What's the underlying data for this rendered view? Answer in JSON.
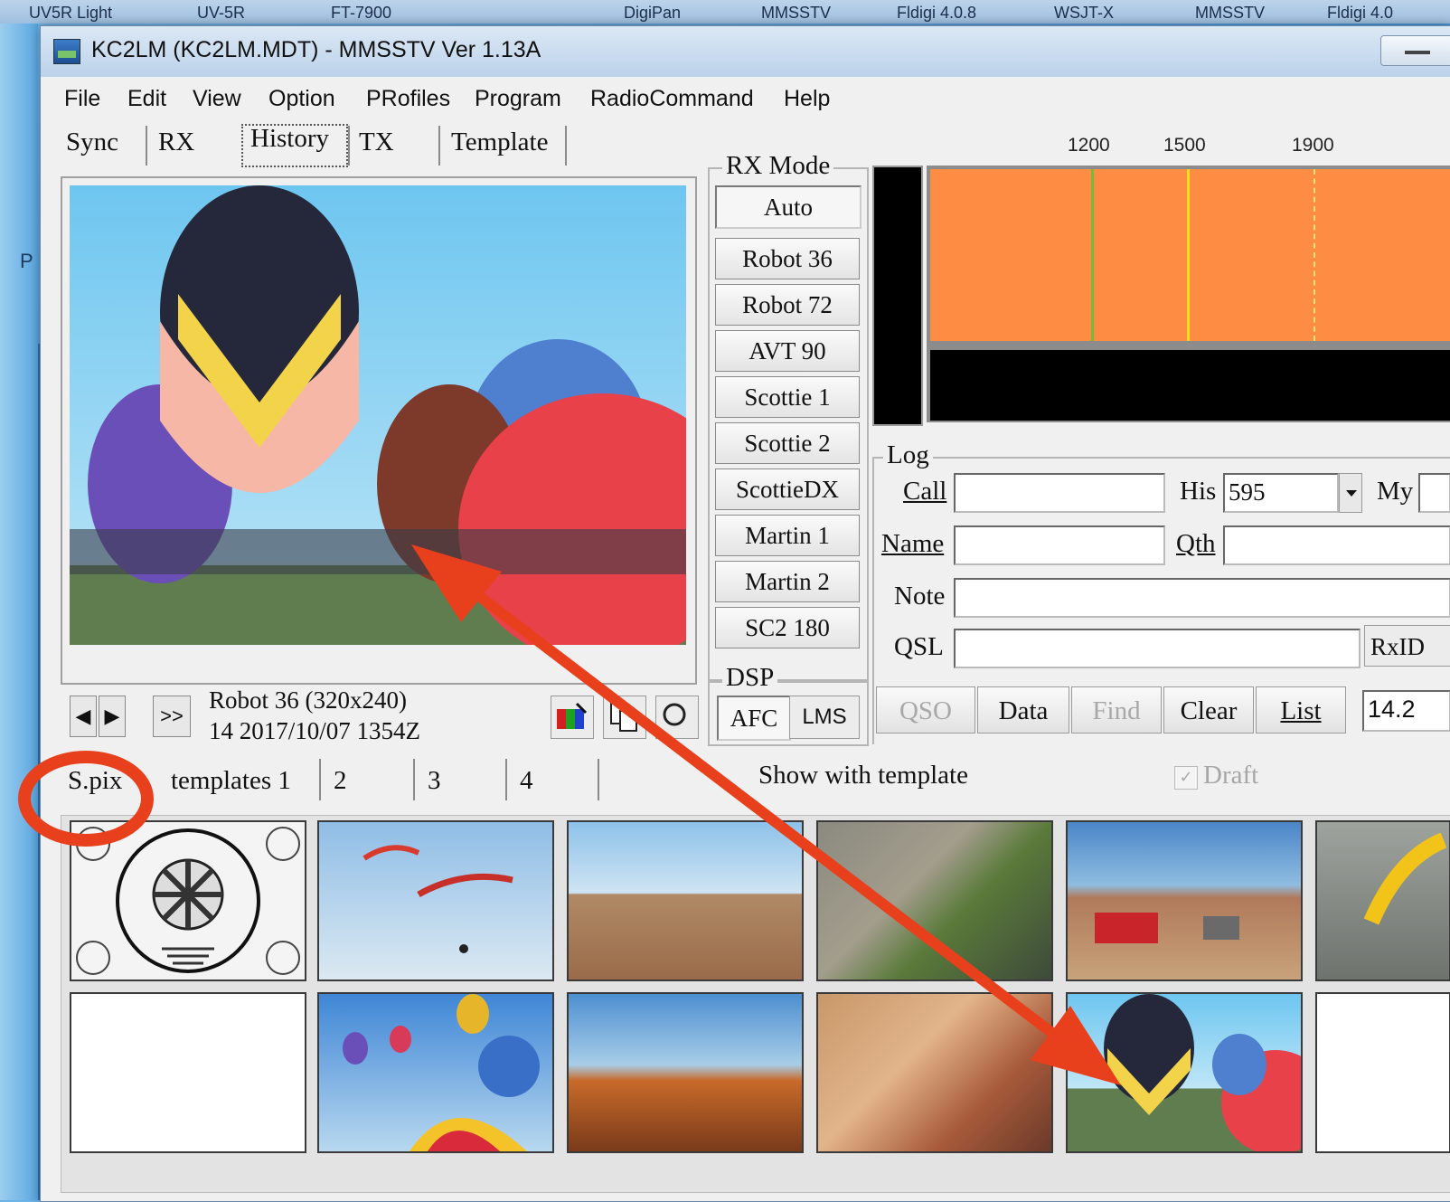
{
  "taskbar": {
    "items": [
      "UV5R Light",
      "UV-5R",
      "FT-7900",
      "DigiPan",
      "MMSSTV",
      "Fldigi 4.0.8",
      "WSJT-X",
      "MMSSTV",
      "Fldigi 4.0"
    ]
  },
  "desktop": {
    "letter": "P"
  },
  "window": {
    "title": "KC2LM (KC2LM.MDT) - MMSSTV Ver 1.13A"
  },
  "menu": [
    "File",
    "Edit",
    "View",
    "Option",
    "PRofiles",
    "Program",
    "RadioCommand",
    "Help"
  ],
  "tabs": [
    "Sync",
    "RX",
    "History",
    "TX",
    "Template"
  ],
  "history": {
    "nav": [
      "◀",
      "▶",
      ">>"
    ],
    "mode_line1": "Robot 36 (320x240)",
    "mode_line2": "14 2017/10/07 1354Z"
  },
  "rx_mode": {
    "label": "RX Mode",
    "modes": [
      "Auto",
      "Robot 36",
      "Robot 72",
      "AVT 90",
      "Scottie 1",
      "Scottie 2",
      "ScottieDX",
      "Martin 1",
      "Martin 2",
      "SC2 180"
    ]
  },
  "dsp": {
    "label": "DSP",
    "afc": "AFC",
    "lms": "LMS"
  },
  "spectrum": {
    "freq_labels": [
      "1200",
      "1500",
      "1900"
    ]
  },
  "log": {
    "label": "Log",
    "call_label": "Call",
    "his_label": "His",
    "his_value": "595",
    "my_label": "My",
    "name_label": "Name",
    "qth_label": "Qth",
    "note_label": "Note",
    "qsl_label": "QSL",
    "rxid_label": "RxID",
    "buttons": [
      "QSO",
      "Data",
      "Find",
      "Clear",
      "List"
    ],
    "freq_value": "14.2"
  },
  "bottom_tabs": [
    "S.pix",
    "templates 1",
    "2",
    "3",
    "4"
  ],
  "options": {
    "show_template": "Show with template",
    "draft": "Draft"
  },
  "colors": {
    "spectrum": "#fe8c42",
    "annotation": "#e8401c"
  }
}
